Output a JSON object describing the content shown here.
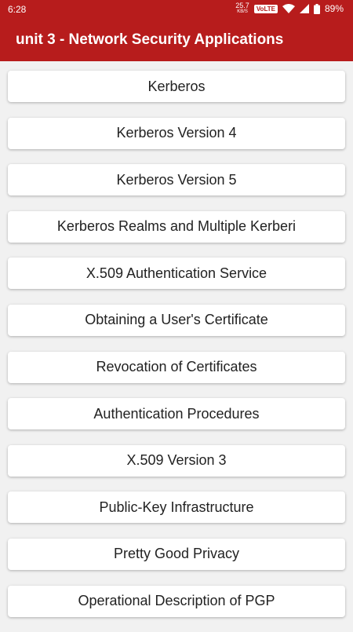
{
  "status_bar": {
    "time": "6:28",
    "net_speed_value": "25.7",
    "net_speed_unit": "KB/S",
    "volte": "VoLTE",
    "signal_marker": "x",
    "battery": "89%"
  },
  "header": {
    "title": "unit 3 - Network Security Applications",
    "background_color": "#b71c1c"
  },
  "topics": [
    "Kerberos",
    "Kerberos Version 4",
    "Kerberos Version 5",
    "Kerberos Realms and Multiple Kerberi",
    "X.509 Authentication Service",
    "Obtaining a User's Certificate",
    "Revocation of Certificates",
    "Authentication Procedures",
    "X.509 Version 3",
    "Public-Key Infrastructure",
    "Pretty Good Privacy",
    "Operational Description of PGP"
  ]
}
